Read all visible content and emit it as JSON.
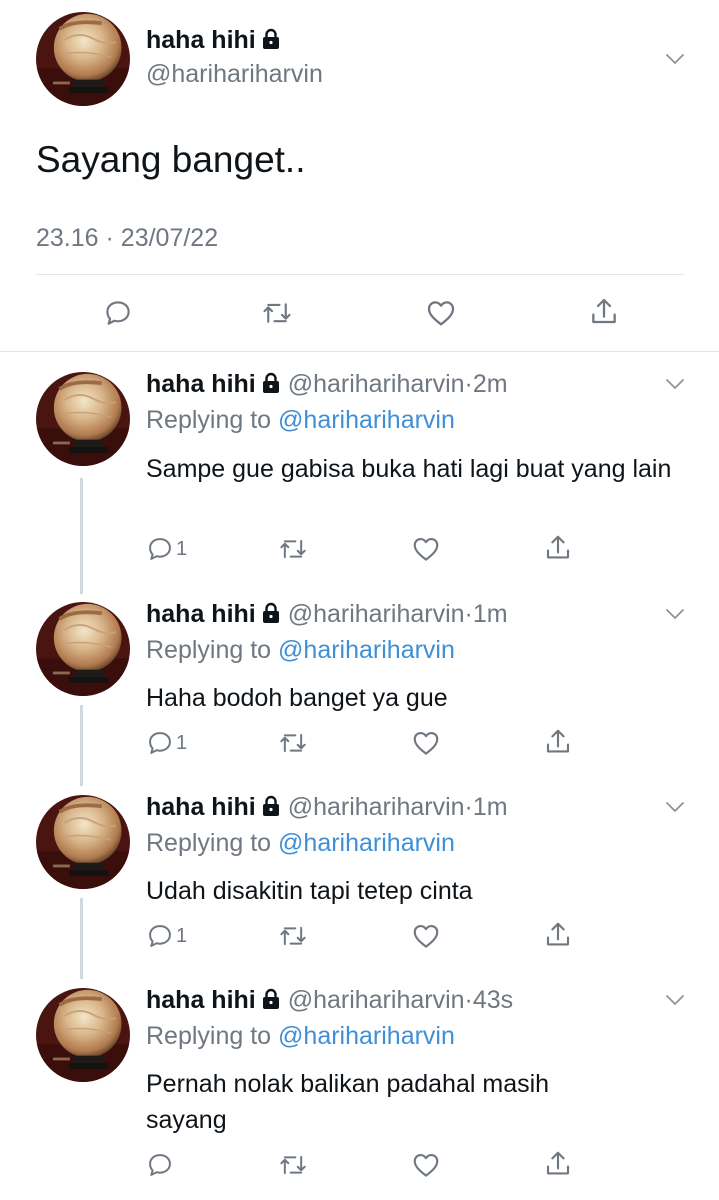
{
  "main_tweet": {
    "display_name": "haha hihi",
    "handle": "@harihariharvin",
    "text": "Sayang banget..",
    "time": "23.16",
    "date": "23/07/22",
    "separator": "·"
  },
  "icons": {
    "reply": "reply-icon",
    "retweet": "retweet-icon",
    "like": "heart-icon",
    "share": "share-icon",
    "more": "chevron-down-icon",
    "lock": "lock-icon"
  },
  "replies": [
    {
      "display_name": "haha hihi",
      "handle": "@harihariharvin",
      "time": "2m",
      "replying_label": "Replying to",
      "replying_to": "@harihariharvin",
      "text": "Sampe gue gabisa buka hati lagi buat yang lain",
      "reply_count": "1"
    },
    {
      "display_name": "haha hihi",
      "handle": "@harihariharvin",
      "time": "1m",
      "replying_label": "Replying to",
      "replying_to": "@harihariharvin",
      "text": "Haha bodoh banget ya gue",
      "reply_count": "1"
    },
    {
      "display_name": "haha hihi",
      "handle": "@harihariharvin",
      "time": "1m",
      "replying_label": "Replying to",
      "replying_to": "@harihariharvin",
      "text": "Udah disakitin tapi tetep cinta",
      "reply_count": "1"
    },
    {
      "display_name": "haha hihi",
      "handle": "@harihariharvin",
      "time": "43s",
      "replying_label": "Replying to",
      "replying_to": "@harihariharvin",
      "text": "Pernah nolak balikan padahal masih sayang",
      "reply_count": ""
    }
  ],
  "colors": {
    "text": "#0f1419",
    "secondary": "#6f7780",
    "link": "#3f8fd7",
    "divider": "#e1e6ea"
  }
}
